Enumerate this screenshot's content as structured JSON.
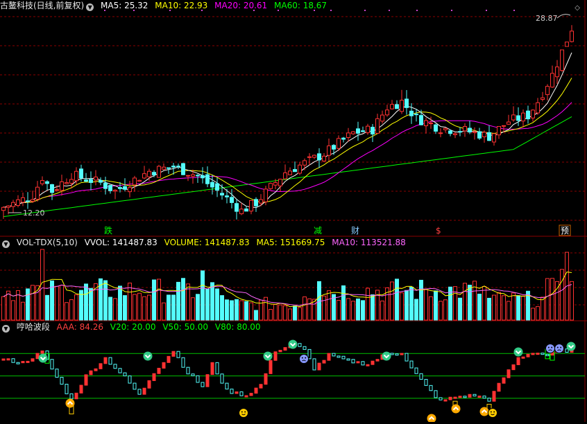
{
  "colors": {
    "bg": "#000000",
    "up": "#ff3232",
    "down": "#54fcfc",
    "grid": "#8b0000",
    "ma5": "#ffffff",
    "ma10": "#ffff00",
    "ma20": "#ff00ff",
    "ma60": "#00ff00",
    "vma5": "#ffff00",
    "vma10": "#ff66ff",
    "green": "#00c000"
  },
  "main": {
    "title": "古鳌科技(日线,前复权)",
    "ma5": "MA5: 25.32",
    "ma10": "MA10: 22.93",
    "ma20": "MA20: 20.61",
    "ma60": "MA60: 18.67",
    "high_label": "28.87",
    "low_label": "12.20",
    "markers": [
      {
        "text": "跌",
        "color": "#00ff00"
      },
      {
        "text": "减",
        "color": "#00ff00"
      },
      {
        "text": "财",
        "color": "#88ccff"
      },
      {
        "text": "$",
        "color": "#ff4040"
      },
      {
        "text": "预",
        "color": "#ffffff"
      }
    ],
    "dots_icon": "corner-diamond-icon"
  },
  "volume": {
    "title": "VOL-TDX(5,10)",
    "vvol": "VVOL: 141487.83",
    "volume": "VOLUME: 141487.83",
    "ma5": "MA5: 151669.75",
    "ma10": "MA10: 113521.88"
  },
  "wave": {
    "title": "哼哈波段",
    "aaa": "AAA: 84.26",
    "v20": "V20: 20.00",
    "v50": "V50: 50.00",
    "v80": "V80: 80.00",
    "icons": [
      "smiley-top-icon",
      "sad-face-icon",
      "happy-face-icon",
      "smiley-bottom-icon"
    ]
  }
}
